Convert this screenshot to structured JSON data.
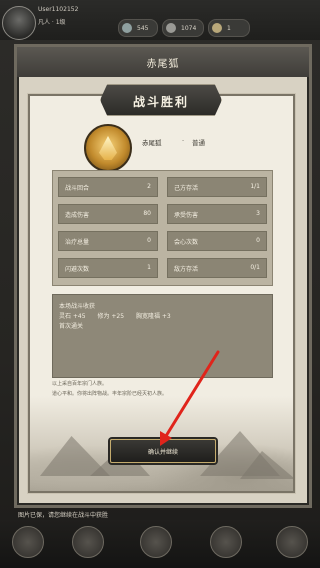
{
  "topbar": {
    "username": "User1102152",
    "level": "凡人 · 1级",
    "resources": [
      {
        "icon": "jade-icon",
        "value": "545"
      },
      {
        "icon": "sword-icon",
        "value": "1074"
      },
      {
        "icon": "scroll-icon",
        "value": "1"
      }
    ]
  },
  "window": {
    "title": "赤尾狐"
  },
  "dialog": {
    "ribbon": "战斗胜利",
    "beast_name": "赤尾狐",
    "separator": "·",
    "mode": "普通",
    "stats": [
      {
        "label": "战斗回合",
        "value": "2"
      },
      {
        "label": "己方存活",
        "value": "1/1"
      },
      {
        "label": "造成伤害",
        "value": "80"
      },
      {
        "label": "承受伤害",
        "value": "3"
      },
      {
        "label": "治疗总量",
        "value": "0"
      },
      {
        "label": "会心次数",
        "value": "0"
      },
      {
        "label": "闪避次数",
        "value": "1"
      },
      {
        "label": "敌方存活",
        "value": "0/1"
      }
    ],
    "reward": {
      "title": "本场战斗收获",
      "items": [
        "灵石 +45",
        "修为 +25",
        "胸宽隆福 +3"
      ],
      "first_clear": "首次通关"
    },
    "log": [
      "以上采自百年宗门人族。",
      "道心平和。你将出阵物战。丰年宗阶已经灭初人族。"
    ],
    "confirm_label": "确认并继续"
  },
  "footer": {
    "text": "图片已保，请您继续在战斗中获胜"
  },
  "colors": {
    "accent": "#c4ab6d",
    "arrow": "#e0241b"
  }
}
